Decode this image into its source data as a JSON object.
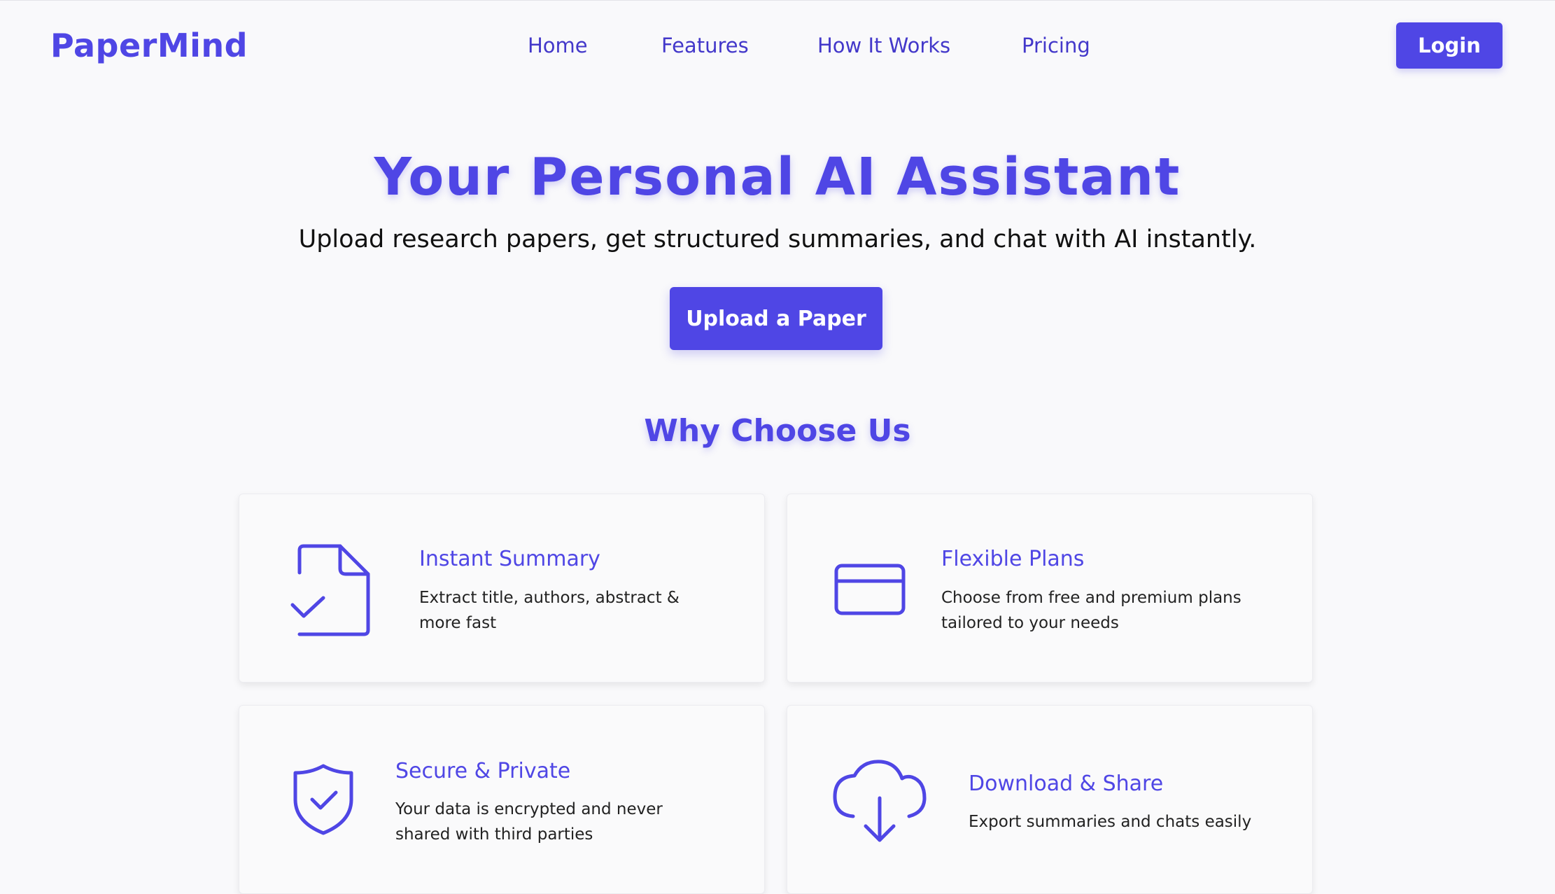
{
  "brand": {
    "name": "PaperMind",
    "accent_color": "#4f46e5"
  },
  "nav": {
    "items": [
      {
        "label": "Home"
      },
      {
        "label": "Features"
      },
      {
        "label": "How It Works"
      },
      {
        "label": "Pricing"
      }
    ],
    "login_label": "Login"
  },
  "hero": {
    "title": "Your Personal AI Assistant",
    "subtitle": "Upload research papers, get structured summaries, and chat with AI instantly.",
    "cta_label": "Upload a Paper"
  },
  "features": {
    "heading": "Why Choose Us",
    "cards": [
      {
        "icon": "document-check-icon",
        "title": "Instant Summary",
        "description": "Extract title, authors, abstract & more fast"
      },
      {
        "icon": "credit-card-icon",
        "title": "Flexible Plans",
        "description": "Choose from free and premium plans tailored to your needs"
      },
      {
        "icon": "shield-check-icon",
        "title": "Secure & Private",
        "description": "Your data is encrypted and never shared with third parties"
      },
      {
        "icon": "cloud-download-icon",
        "title": "Download & Share",
        "description": "Export summaries and chats easily"
      }
    ]
  }
}
